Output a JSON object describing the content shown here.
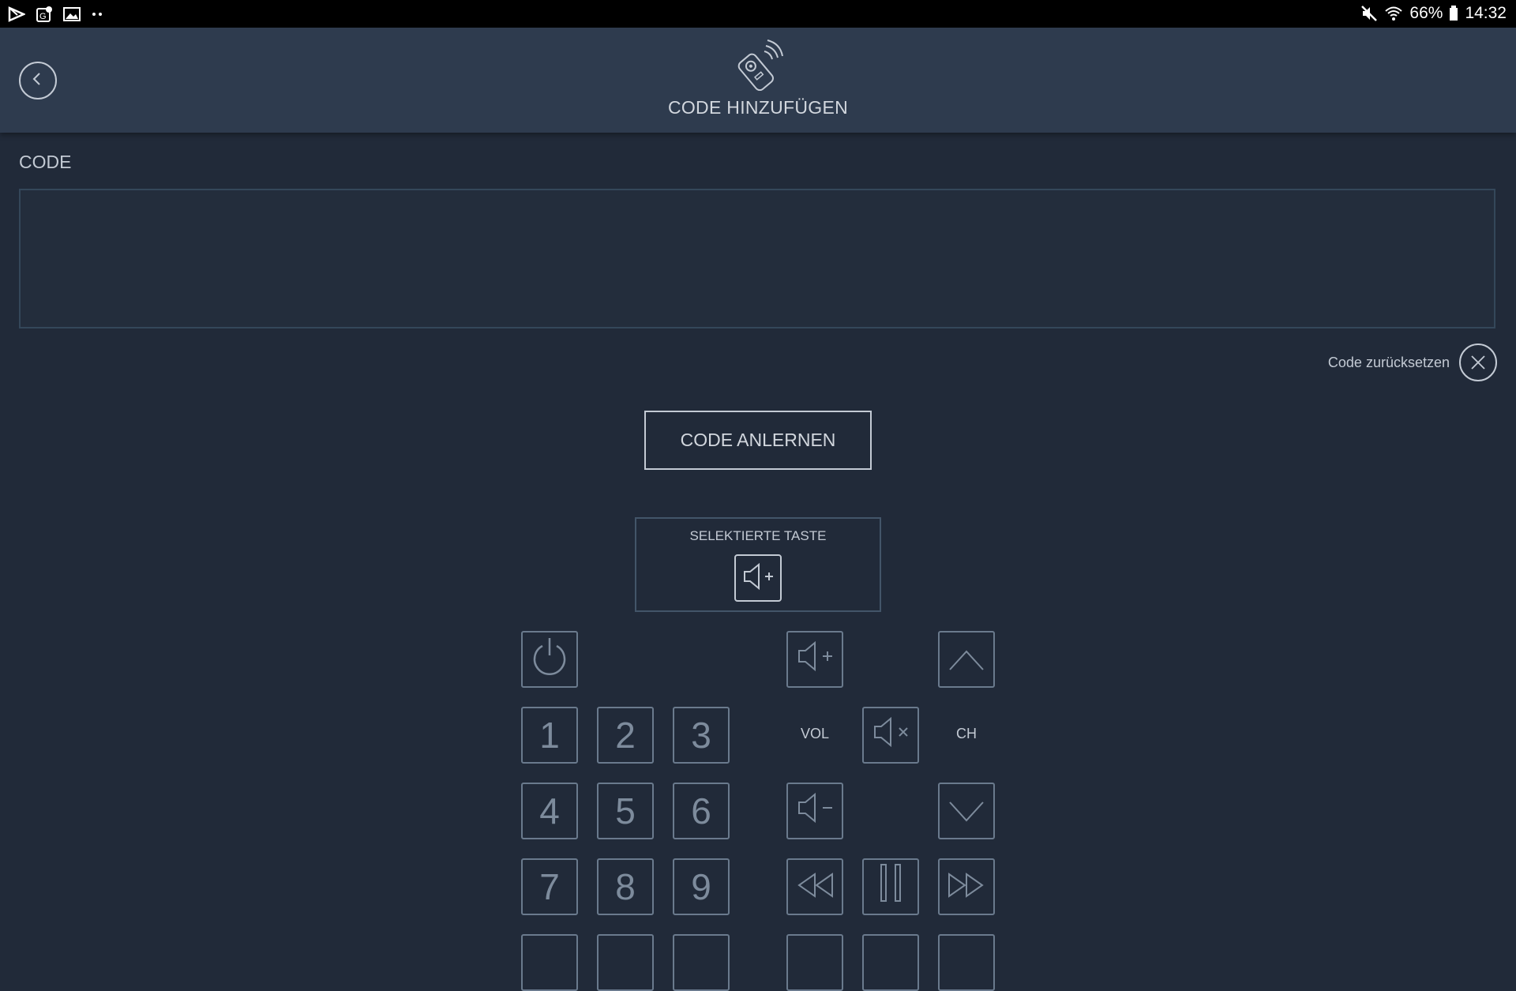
{
  "status_bar": {
    "battery": "66%",
    "time": "14:32",
    "left_icons": [
      "play-store-icon",
      "maps-icon",
      "gallery-icon",
      "more-dots-icon"
    ],
    "right_icons": [
      "mute-icon",
      "wifi-icon",
      "battery-icon"
    ]
  },
  "header": {
    "title": "CODE HINZUFÜGEN",
    "icon": "remote-control-icon",
    "back_icon": "back-arrow-icon"
  },
  "code_section": {
    "label": "CODE",
    "value": "",
    "reset_label": "Code zurücksetzen"
  },
  "learn_button": {
    "label": "CODE ANLERNEN"
  },
  "selected_key": {
    "label": "SELEKTIERTE TASTE",
    "icon": "volume-up-icon"
  },
  "keypad": {
    "digits": [
      "1",
      "2",
      "3",
      "4",
      "5",
      "6",
      "7",
      "8",
      "9"
    ],
    "vol_label": "VOL",
    "ch_label": "CH"
  },
  "colors": {
    "background": "#212a39",
    "header": "#2e3b4e",
    "text": "#c3cad4",
    "key_border": "#6a7a8d"
  }
}
